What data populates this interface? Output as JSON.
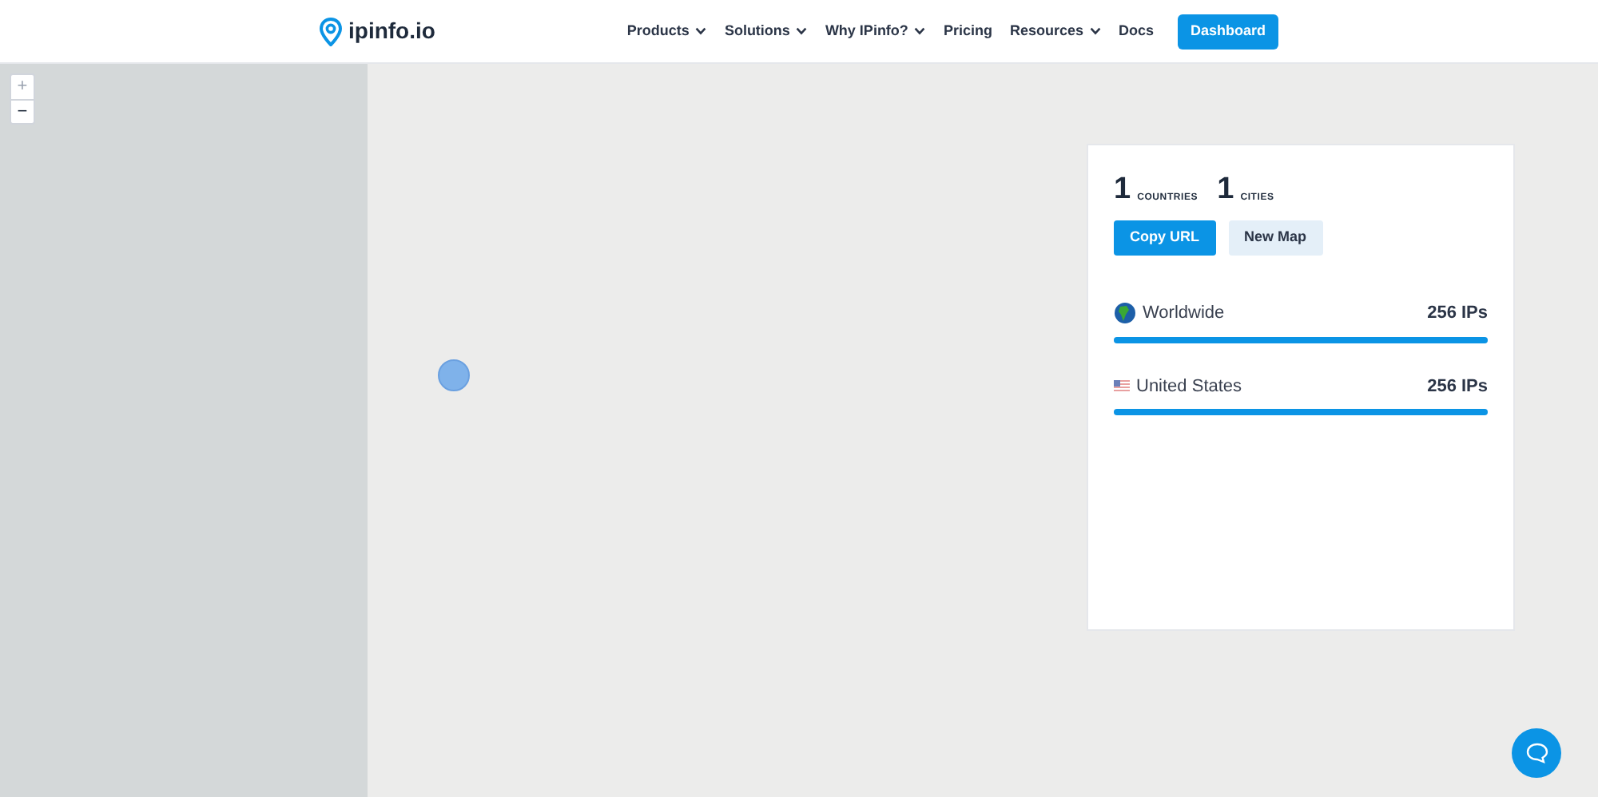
{
  "header": {
    "logo": "ipinfo.io",
    "nav": [
      {
        "label": "Products",
        "dropdown": true
      },
      {
        "label": "Solutions",
        "dropdown": true
      },
      {
        "label": "Why IPinfo?",
        "dropdown": true
      },
      {
        "label": "Pricing",
        "dropdown": false
      },
      {
        "label": "Resources",
        "dropdown": true
      },
      {
        "label": "Docs",
        "dropdown": false
      }
    ],
    "cta": "Dashboard"
  },
  "map": {
    "zoom": [
      {
        "label": "+",
        "disabled": true
      },
      {
        "label": "−",
        "disabled": false
      }
    ]
  },
  "panel": {
    "stats": [
      {
        "count": "1",
        "label": "COUNTRIES"
      },
      {
        "count": "1",
        "label": "CITIES"
      }
    ],
    "buttons": [
      {
        "label": "Copy URL",
        "kind": "primary"
      },
      {
        "label": "New Map",
        "kind": "secondary"
      }
    ],
    "rows": [
      {
        "kind": "globe",
        "name": "Worldwide",
        "value": "256 IPs",
        "level": 1
      },
      {
        "kind": "flag",
        "name": "United States",
        "value": "256 IPs",
        "level": 1
      }
    ]
  }
}
